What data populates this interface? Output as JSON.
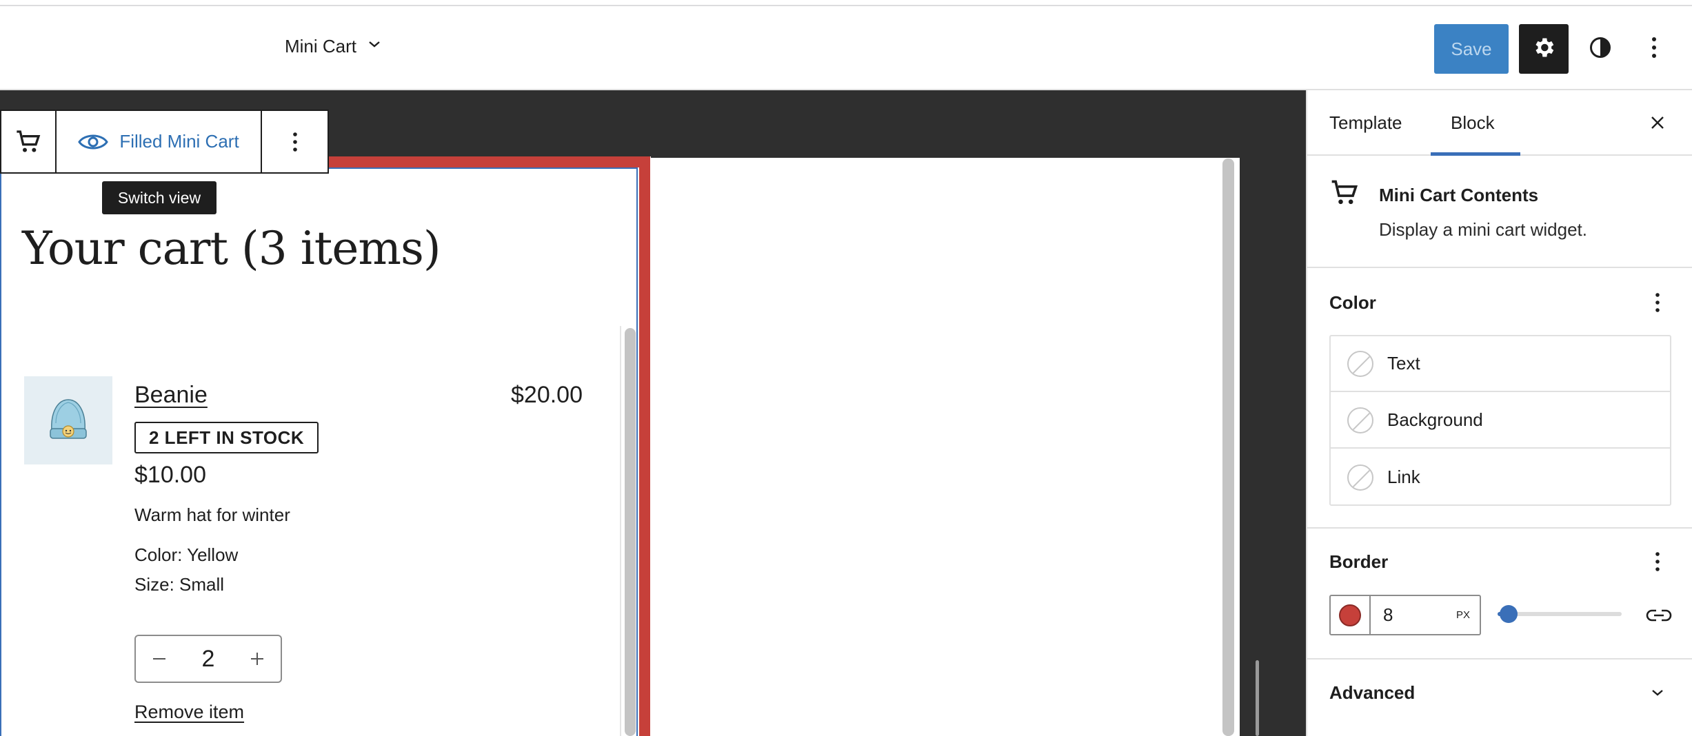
{
  "header": {
    "document_title": "Mini Cart",
    "save_label": "Save",
    "settings_icon": "gear-icon",
    "styles_icon": "half-circle-icon",
    "options_icon": "vertical-ellipsis-icon"
  },
  "block_toolbar": {
    "block_icon": "cart-icon",
    "view_icon": "eye-icon",
    "view_label": "Filled Mini Cart",
    "more_icon": "vertical-ellipsis-icon",
    "tooltip": "Switch view"
  },
  "cart": {
    "title": "Your cart (3 items)",
    "items": [
      {
        "name": "Beanie",
        "line_price": "$20.00",
        "stock_badge": "2 LEFT IN STOCK",
        "unit_price": "$10.00",
        "description": "Warm hat for winter",
        "color": "Color: Yellow",
        "size": "Size: Small",
        "quantity": "2",
        "remove_label": "Remove item"
      }
    ]
  },
  "sidebar": {
    "tabs": [
      "Template",
      "Block"
    ],
    "active_tab": "Block",
    "block": {
      "title": "Mini Cart Contents",
      "description": "Display a mini cart widget."
    },
    "color": {
      "title": "Color",
      "items": [
        "Text",
        "Background",
        "Link"
      ]
    },
    "border": {
      "title": "Border",
      "width": "8",
      "unit": "PX",
      "color": "#c6403a"
    },
    "advanced": {
      "title": "Advanced"
    }
  },
  "colors": {
    "accent": "#3a6fb8",
    "border_red": "#c6403a",
    "canvas_bg": "#2f2f2f",
    "dark": "#1e1e1e"
  }
}
